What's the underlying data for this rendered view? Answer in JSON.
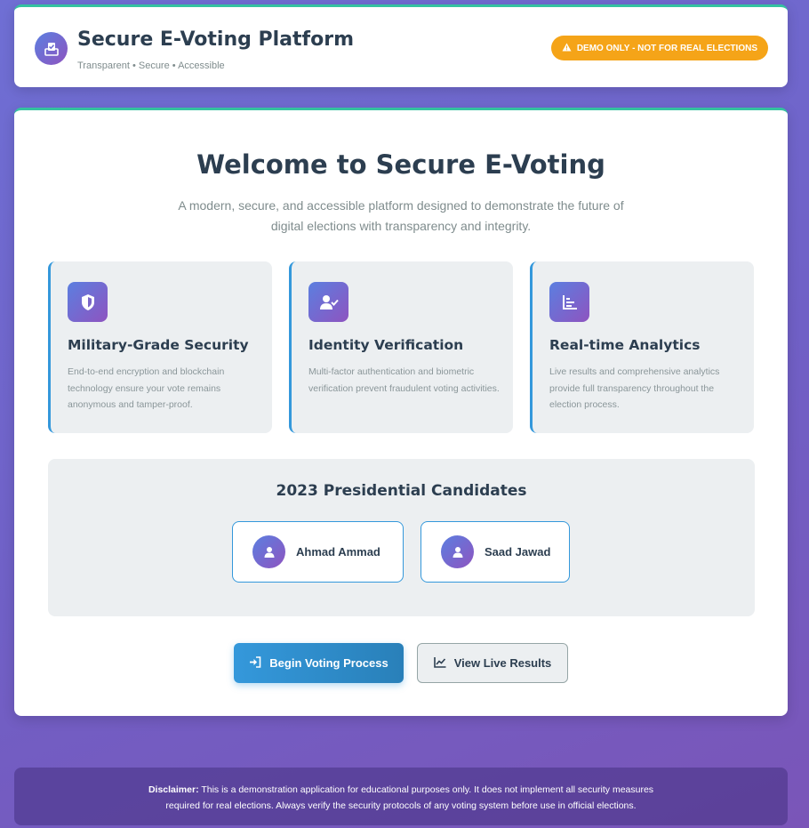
{
  "header": {
    "title": "Secure E-Voting Platform",
    "subtitle": "Transparent • Secure • Accessible",
    "logo_icon": "ballot-check-icon",
    "demo_badge": "DEMO ONLY - NOT FOR REAL ELECTIONS",
    "demo_badge_icon": "warning-icon"
  },
  "main": {
    "title": "Welcome to Secure E-Voting",
    "description_line1": "A modern, secure, and accessible platform designed to demonstrate the future of",
    "description_line2": "digital elections with transparency and integrity.",
    "features": [
      {
        "icon": "shield-icon",
        "title": "Military-Grade Security",
        "description": "End-to-end encryption and blockchain technology ensure your vote remains anonymous and tamper-proof."
      },
      {
        "icon": "user-check-icon",
        "title": "Identity Verification",
        "description": "Multi-factor authentication and biometric verification prevent fraudulent voting activities."
      },
      {
        "icon": "chart-bar-icon",
        "title": "Real-time Analytics",
        "description": "Live results and comprehensive analytics provide full transparency throughout the election process."
      }
    ],
    "candidates": {
      "title": "2023 Presidential Candidates",
      "items": [
        {
          "name": "Ahmad Ammad",
          "icon": "user-icon"
        },
        {
          "name": "Saad Jawad",
          "icon": "user-icon"
        }
      ]
    },
    "buttons": {
      "begin_label": "Begin Voting Process",
      "begin_icon": "sign-in-icon",
      "results_label": "View Live Results",
      "results_icon": "chart-line-icon"
    }
  },
  "footer": {
    "label": "Disclaimer:",
    "text_line1": "This is a demonstration application for educational purposes only. It does not implement all security measures",
    "text_line2": "required for real elections. Always verify the security protocols of any voting system before use in official elections."
  },
  "colors": {
    "accent": "#3498db",
    "badge": "#f5a418",
    "heading": "#2c3e50",
    "icon_gradient_start": "#5b7fe0",
    "icon_gradient_end": "#8e54c0"
  }
}
